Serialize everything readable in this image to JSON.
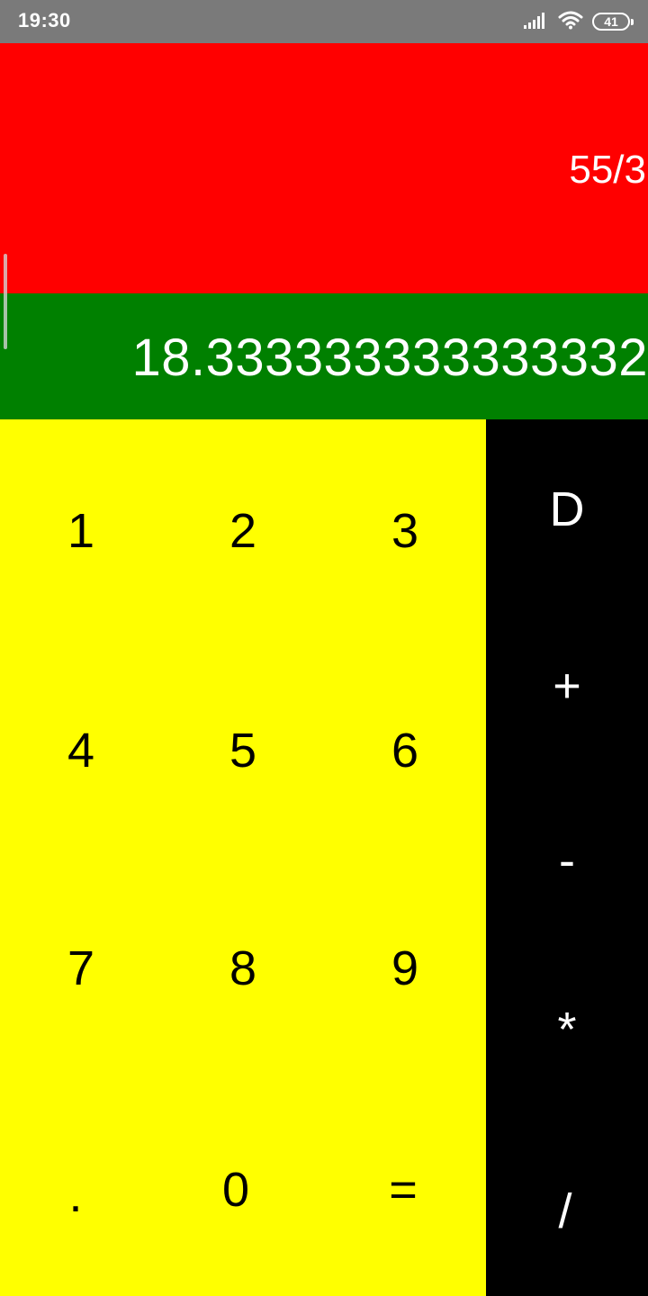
{
  "status_bar": {
    "time": "19:30",
    "battery_level": "41",
    "icons": [
      "signal-icon",
      "wifi-icon",
      "battery-icon"
    ]
  },
  "display": {
    "expression": "55/3",
    "result": "18.333333333333332"
  },
  "keypad": {
    "digits": [
      "1",
      "2",
      "3",
      "4",
      "5",
      "6",
      "7",
      "8",
      "9",
      ".",
      "0",
      "="
    ],
    "operators": [
      "D",
      "+",
      "-",
      "*",
      "/"
    ]
  },
  "colors": {
    "status_bar": "#7a7a7a",
    "expression_background": "#ff0000",
    "result_background": "#008000",
    "digit_pad_background": "#ffff00",
    "operator_pad_background": "#000000"
  }
}
